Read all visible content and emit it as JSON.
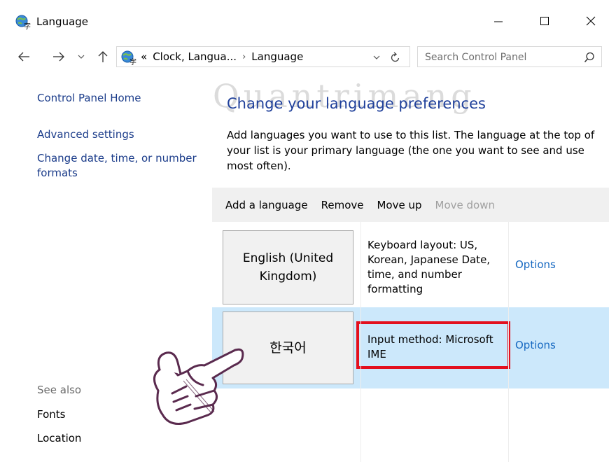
{
  "window": {
    "title": "Language",
    "minimize_glyph": "—",
    "maximize_glyph": "☐",
    "close_glyph": "✕"
  },
  "nav": {
    "back_glyph": "←",
    "forward_glyph": "→",
    "recent_glyph": "⌄",
    "up_glyph": "↑",
    "overflow_glyph": "«",
    "crumbs": [
      "Clock, Langua...",
      "Language"
    ],
    "crumb_separator": "›",
    "dropdown_glyph": "⌄",
    "refresh_glyph": "↻"
  },
  "search": {
    "placeholder": "Search Control Panel",
    "value": ""
  },
  "sidebar": {
    "home": "Control Panel Home",
    "advanced": "Advanced settings",
    "date_time": "Change date, time, or number formats",
    "see_also": "See also",
    "fonts": "Fonts",
    "location": "Location"
  },
  "main": {
    "watermark": "Quantrimang",
    "title": "Change your language preferences",
    "description": "Add languages you want to use to this list. The language at the top of your list is your primary language (the one you want to see and use most often)."
  },
  "toolbar": {
    "add": "Add a language",
    "remove": "Remove",
    "move_up": "Move up",
    "move_down": "Move down"
  },
  "languages": [
    {
      "name": "English (United Kingdom)",
      "info": "Keyboard layout: US, Korean, Japanese Date, time, and number formatting",
      "options": "Options",
      "selected": false
    },
    {
      "name": "한국어",
      "info": "Input method: Microsoft IME",
      "options": "Options",
      "selected": true
    }
  ],
  "colors": {
    "link_blue": "#1769c1",
    "title_blue": "#1e3f9a",
    "selected_row": "#cce8fb",
    "highlight_red": "#e3101e",
    "hand_outline": "#5a2a4e"
  }
}
